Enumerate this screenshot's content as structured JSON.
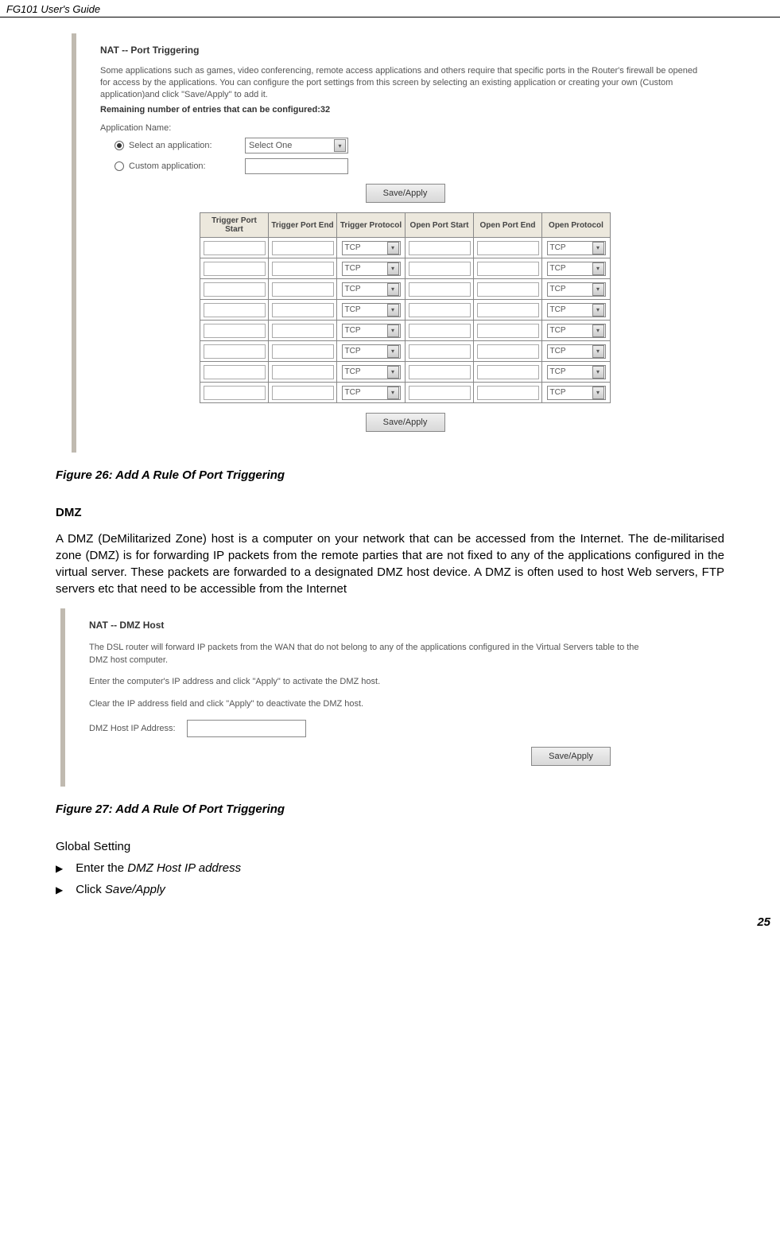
{
  "header": "FG101 User's Guide",
  "pt": {
    "title": "NAT -- Port Triggering",
    "desc1": "Some applications such as games, video conferencing, remote access applications and others require that specific ports in the Router's firewall be opened for access by the applications. You can configure the port settings from this screen by selecting an existing application or creating your own (Custom application)and click \"Save/Apply\" to add it.",
    "desc2": "Remaining number of entries that can be configured:32",
    "appNameLabel": "Application Name:",
    "radioSelectLabel": "Select an application:",
    "radioCustomLabel": "Custom application:",
    "selectOne": "Select One",
    "saveApply": "Save/Apply",
    "cols": [
      "Trigger Port Start",
      "Trigger Port End",
      "Trigger Protocol",
      "Open Port Start",
      "Open Port End",
      "Open Protocol"
    ],
    "tcp": "TCP"
  },
  "caption1": "Figure 26: Add A Rule Of Port Triggering",
  "dmzHeading": "DMZ",
  "dmzBody": "A DMZ (DeMilitarized Zone) host is a computer on your network that can be accessed from the Internet. The de-militarised zone (DMZ) is for forwarding IP packets from the remote parties that are not fixed to any of the applications configured in the virtual server. These packets are forwarded to a designated DMZ host device. A DMZ is often used to host Web servers, FTP servers etc that need to be accessible from the Internet",
  "dmz": {
    "title": "NAT -- DMZ Host",
    "p1": "The DSL router will forward IP packets from the WAN that do not belong to any of the applications configured in the Virtual Servers table to the DMZ host computer.",
    "p2": "Enter the computer's IP address and click \"Apply\" to activate the DMZ host.",
    "p3": "Clear the IP address field and click \"Apply\" to deactivate the DMZ host.",
    "ipLabel": "DMZ Host IP Address:",
    "saveApply": "Save/Apply"
  },
  "caption2": "Figure 27: Add A Rule Of Port Triggering",
  "globalSetting": "Global Setting",
  "bullet1a": "Enter the ",
  "bullet1b": "DMZ Host IP address",
  "bullet2a": "Click ",
  "bullet2b": "Save/Apply",
  "pageNum": "25"
}
